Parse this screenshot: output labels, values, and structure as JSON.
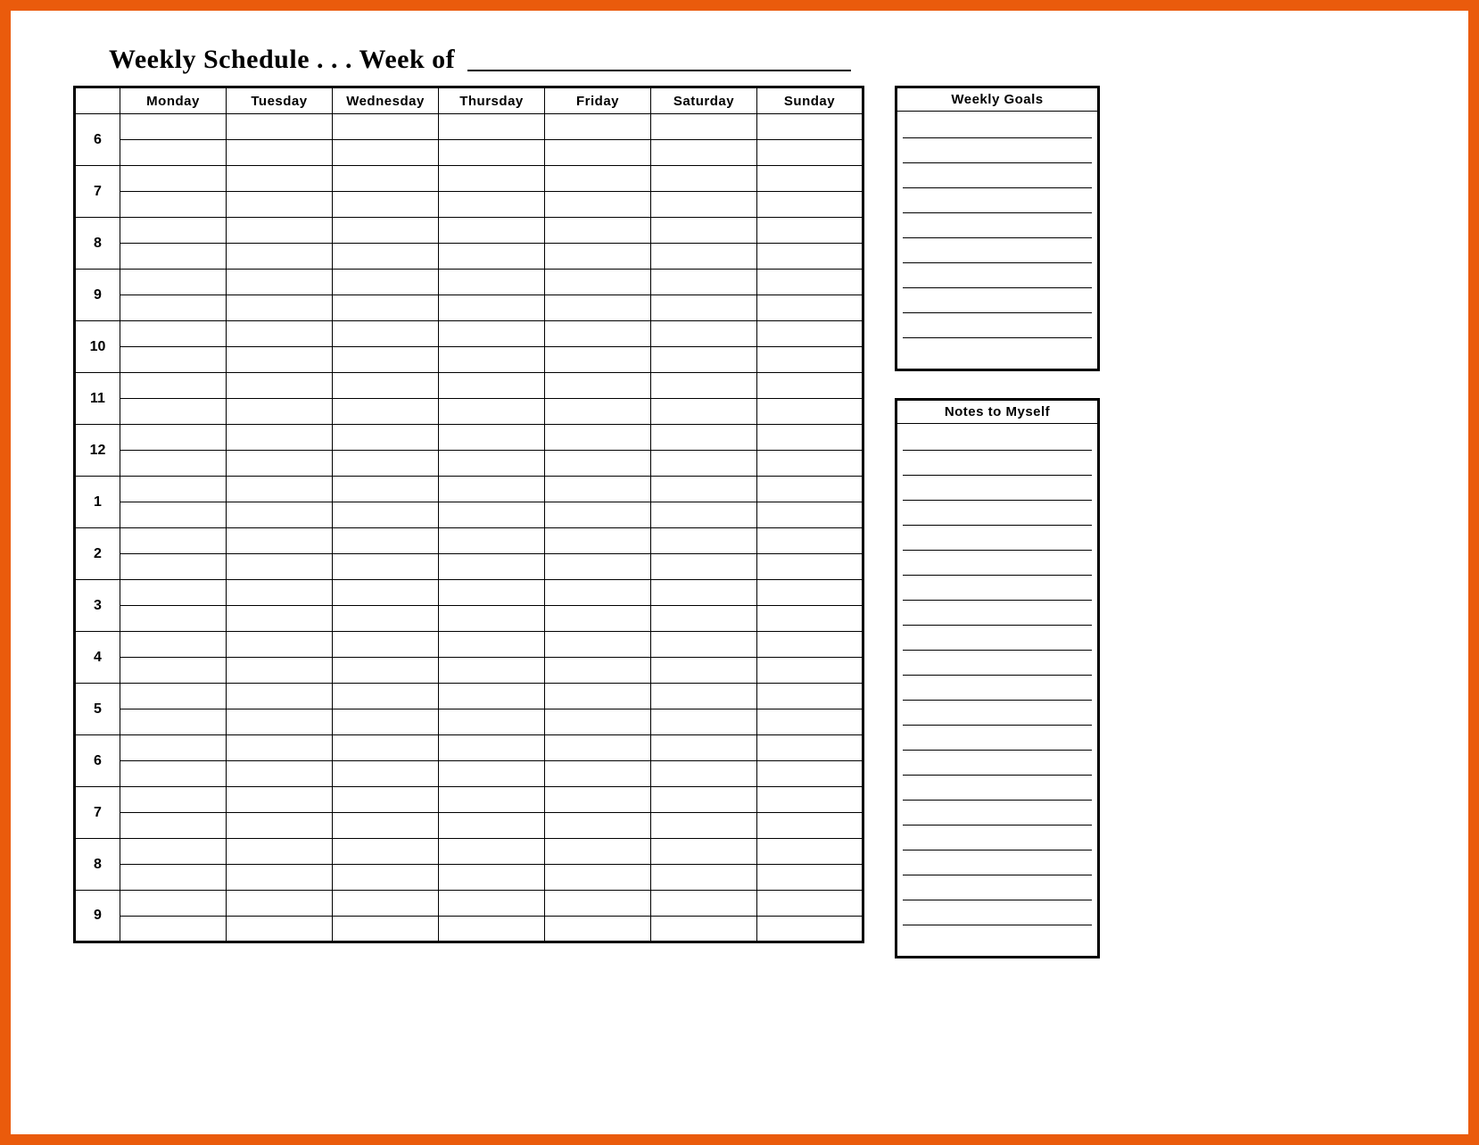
{
  "title": {
    "prefix": "Weekly Schedule . . . Week of ",
    "value": ""
  },
  "schedule": {
    "corner": "",
    "days": [
      "Monday",
      "Tuesday",
      "Wednesday",
      "Thursday",
      "Friday",
      "Saturday",
      "Sunday"
    ],
    "hours": [
      "6",
      "7",
      "8",
      "9",
      "10",
      "11",
      "12",
      "1",
      "2",
      "3",
      "4",
      "5",
      "6",
      "7",
      "8",
      "9"
    ],
    "sub_rows_per_hour": 2,
    "cells": {}
  },
  "goals": {
    "header": "Weekly Goals",
    "line_count": 10,
    "lines": [
      "",
      "",
      "",
      "",
      "",
      "",
      "",
      "",
      "",
      ""
    ]
  },
  "notes": {
    "header": "Notes to Myself",
    "line_count": 21,
    "lines": [
      "",
      "",
      "",
      "",
      "",
      "",
      "",
      "",
      "",
      "",
      "",
      "",
      "",
      "",
      "",
      "",
      "",
      "",
      "",
      "",
      ""
    ]
  }
}
